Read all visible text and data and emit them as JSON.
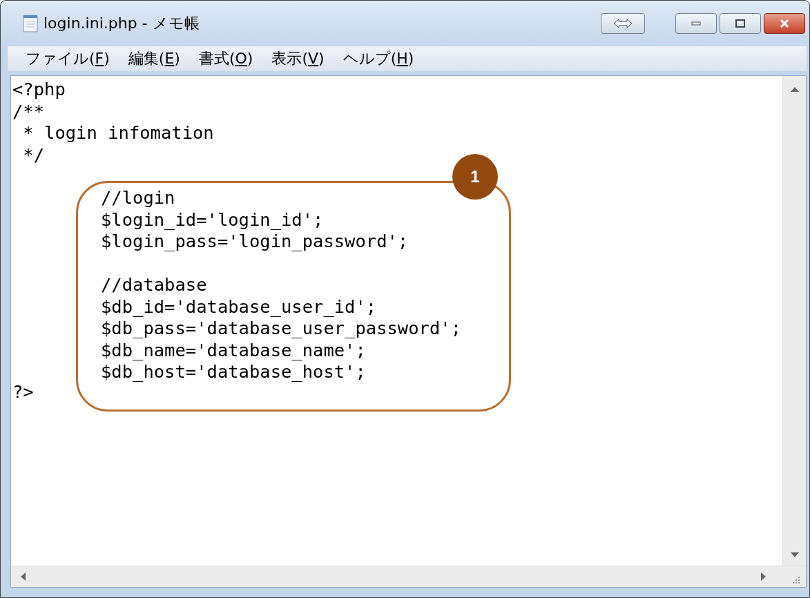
{
  "window": {
    "title": "login.ini.php - メモ帳"
  },
  "menu": [
    {
      "label": "ファイル(",
      "key": "F",
      "after": ")"
    },
    {
      "label": "編集(",
      "key": "E",
      "after": ")"
    },
    {
      "label": "書式(",
      "key": "O",
      "after": ")"
    },
    {
      "label": "表示(",
      "key": "V",
      "after": ")"
    },
    {
      "label": "ヘルプ(",
      "key": "H",
      "after": ")"
    }
  ],
  "editor": {
    "lines_before": [
      "<?php",
      "/**",
      " * login infomation",
      " */"
    ],
    "callout": {
      "number": "1",
      "groups": [
        [
          "//login",
          "$login_id='login_id';",
          "$login_pass='login_password';"
        ],
        [
          "//database",
          "$db_id='database_user_id';",
          "$db_pass='database_user_password';",
          "$db_name='database_name';",
          "$db_host='database_host';"
        ]
      ]
    },
    "lines_after": [
      "?>"
    ]
  }
}
